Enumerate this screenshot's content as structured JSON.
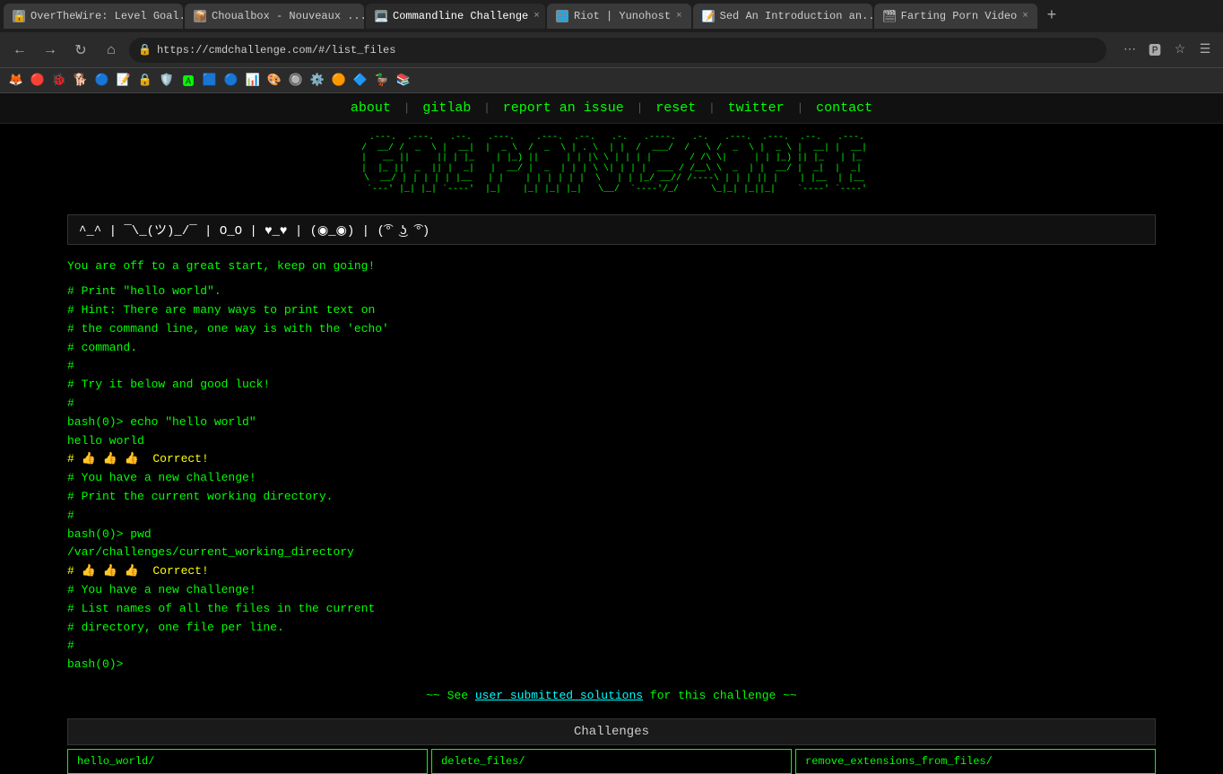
{
  "browser": {
    "tabs": [
      {
        "id": "tab1",
        "favicon": "🔒",
        "label": "OverTheWire: Level Goal...",
        "active": false,
        "closable": true
      },
      {
        "id": "tab2",
        "favicon": "📦",
        "label": "Choualbox - Nouveaux ...",
        "active": false,
        "closable": true
      },
      {
        "id": "tab3",
        "favicon": "💻",
        "label": "Commandline Challenge",
        "active": true,
        "closable": true
      },
      {
        "id": "tab4",
        "favicon": "🌐",
        "label": "Riot | Yunohost",
        "active": false,
        "closable": true
      },
      {
        "id": "tab5",
        "favicon": "📝",
        "label": "Sed An Introduction an...",
        "active": false,
        "closable": true
      },
      {
        "id": "tab6",
        "favicon": "🎬",
        "label": "Farting Porn Video",
        "active": false,
        "closable": true
      }
    ],
    "address": "https://cmdchallenge.com/#/list_files",
    "new_tab_label": "+"
  },
  "extensions": [
    "🦊",
    "🔴",
    "🐞",
    "🔵",
    "🔧",
    "📝",
    "🔒",
    "🛡️",
    "🅰️",
    "🟦",
    "🔵",
    "📊",
    "🎨",
    "🔘",
    "⚙️",
    "🟠",
    "🔷",
    "🦆"
  ],
  "site_nav": {
    "items": [
      "about",
      "|",
      "gitlab",
      "|",
      "report an issue",
      "|",
      "reset",
      "|",
      "twitter",
      "|",
      "contact"
    ]
  },
  "kaomoji": "^_^ | ¯\\_(ツ)_/¯ | O_O | ♥_♥ | (◉_◉) | (͡° ͜ʖ ͡°)",
  "terminal": {
    "intro": "You are off to a great start, keep on going!",
    "lines": [
      {
        "type": "comment",
        "text": "# Print \"hello world\"."
      },
      {
        "type": "comment",
        "text": "# Hint: There are many ways to print text on"
      },
      {
        "type": "comment",
        "text": "# the command line, one way is with the 'echo'"
      },
      {
        "type": "comment",
        "text": "# command."
      },
      {
        "type": "comment",
        "text": "#"
      },
      {
        "type": "comment",
        "text": "# Try it below and good luck!"
      },
      {
        "type": "comment",
        "text": "#"
      },
      {
        "type": "prompt",
        "text": "bash(0)> echo \"hello world\""
      },
      {
        "type": "output",
        "text": "hello world"
      },
      {
        "type": "success",
        "text": "# 👍 👍 👍  Correct!"
      },
      {
        "type": "comment",
        "text": "# You have a new challenge!"
      },
      {
        "type": "comment",
        "text": "# Print the current working directory."
      },
      {
        "type": "comment",
        "text": "#"
      },
      {
        "type": "prompt",
        "text": "bash(0)> pwd"
      },
      {
        "type": "output",
        "text": "/var/challenges/current_working_directory"
      },
      {
        "type": "success",
        "text": "# 👍 👍 👍  Correct!"
      },
      {
        "type": "comment",
        "text": "# You have a new challenge!"
      },
      {
        "type": "comment",
        "text": "# List names of all the files in the current"
      },
      {
        "type": "comment",
        "text": "# directory, one file per line."
      },
      {
        "type": "comment",
        "text": "#"
      },
      {
        "type": "prompt",
        "text": "bash(0)>"
      }
    ],
    "solutions_text_before": "~~ See ",
    "solutions_link": "user submitted solutions",
    "solutions_text_after": " for this challenge ~~"
  },
  "challenges": {
    "title": "Challenges",
    "items": [
      "hello_world/",
      "delete_files/",
      "remove_extensions_from_files/"
    ]
  }
}
